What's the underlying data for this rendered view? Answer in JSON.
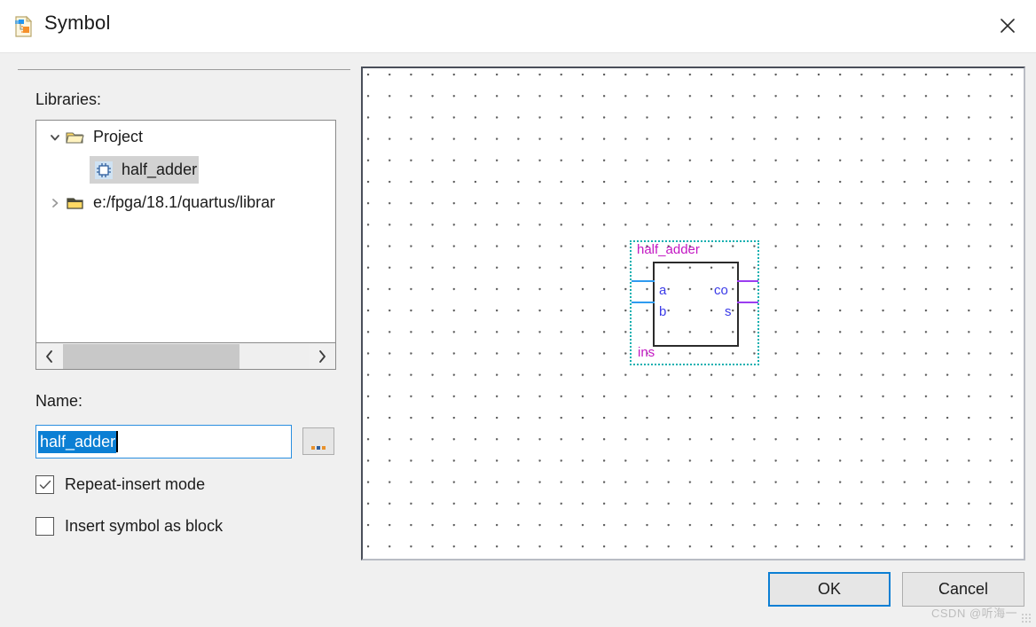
{
  "window": {
    "title": "Symbol",
    "icon": "symbol-document-icon",
    "close_label": "×"
  },
  "left_pane": {
    "libraries_label": "Libraries:",
    "tree": [
      {
        "label": "Project",
        "icon": "open-folder-icon",
        "chevron": "chevron-down-icon",
        "expanded": true,
        "selected": false,
        "level": 1
      },
      {
        "label": "half_adder",
        "icon": "symbol-chip-icon",
        "chevron": "",
        "expanded": false,
        "selected": true,
        "level": 2
      },
      {
        "label": "e:/fpga/18.1/quartus/librar",
        "icon": "closed-folder-icon",
        "chevron": "chevron-right-icon",
        "expanded": false,
        "selected": false,
        "level": 1
      }
    ],
    "scrollbar": {
      "left_arrow": "‹",
      "right_arrow": "›",
      "thumb_percent": 72
    },
    "name_label": "Name:",
    "name_value": "half_adder",
    "name_placeholder": "",
    "browse_label": "...",
    "checkboxes": [
      {
        "label": "Repeat-insert mode",
        "checked": true
      },
      {
        "label": "Insert symbol as block",
        "checked": false
      }
    ]
  },
  "preview": {
    "symbol_name": "half_adder",
    "instance_name": "ins",
    "inputs": [
      "a",
      "b"
    ],
    "outputs": [
      "co",
      "s"
    ],
    "colors": {
      "symbol_label": "#c317c3",
      "pin_label": "#3a3ae8",
      "input_wire": "#2e9bf0",
      "output_wire": "#9b3df0",
      "selection": "#12b0b0",
      "body_border": "#2b2b2b"
    }
  },
  "footer": {
    "ok_label": "OK",
    "cancel_label": "Cancel"
  },
  "watermark": {
    "text": "CSDN @听海一"
  }
}
